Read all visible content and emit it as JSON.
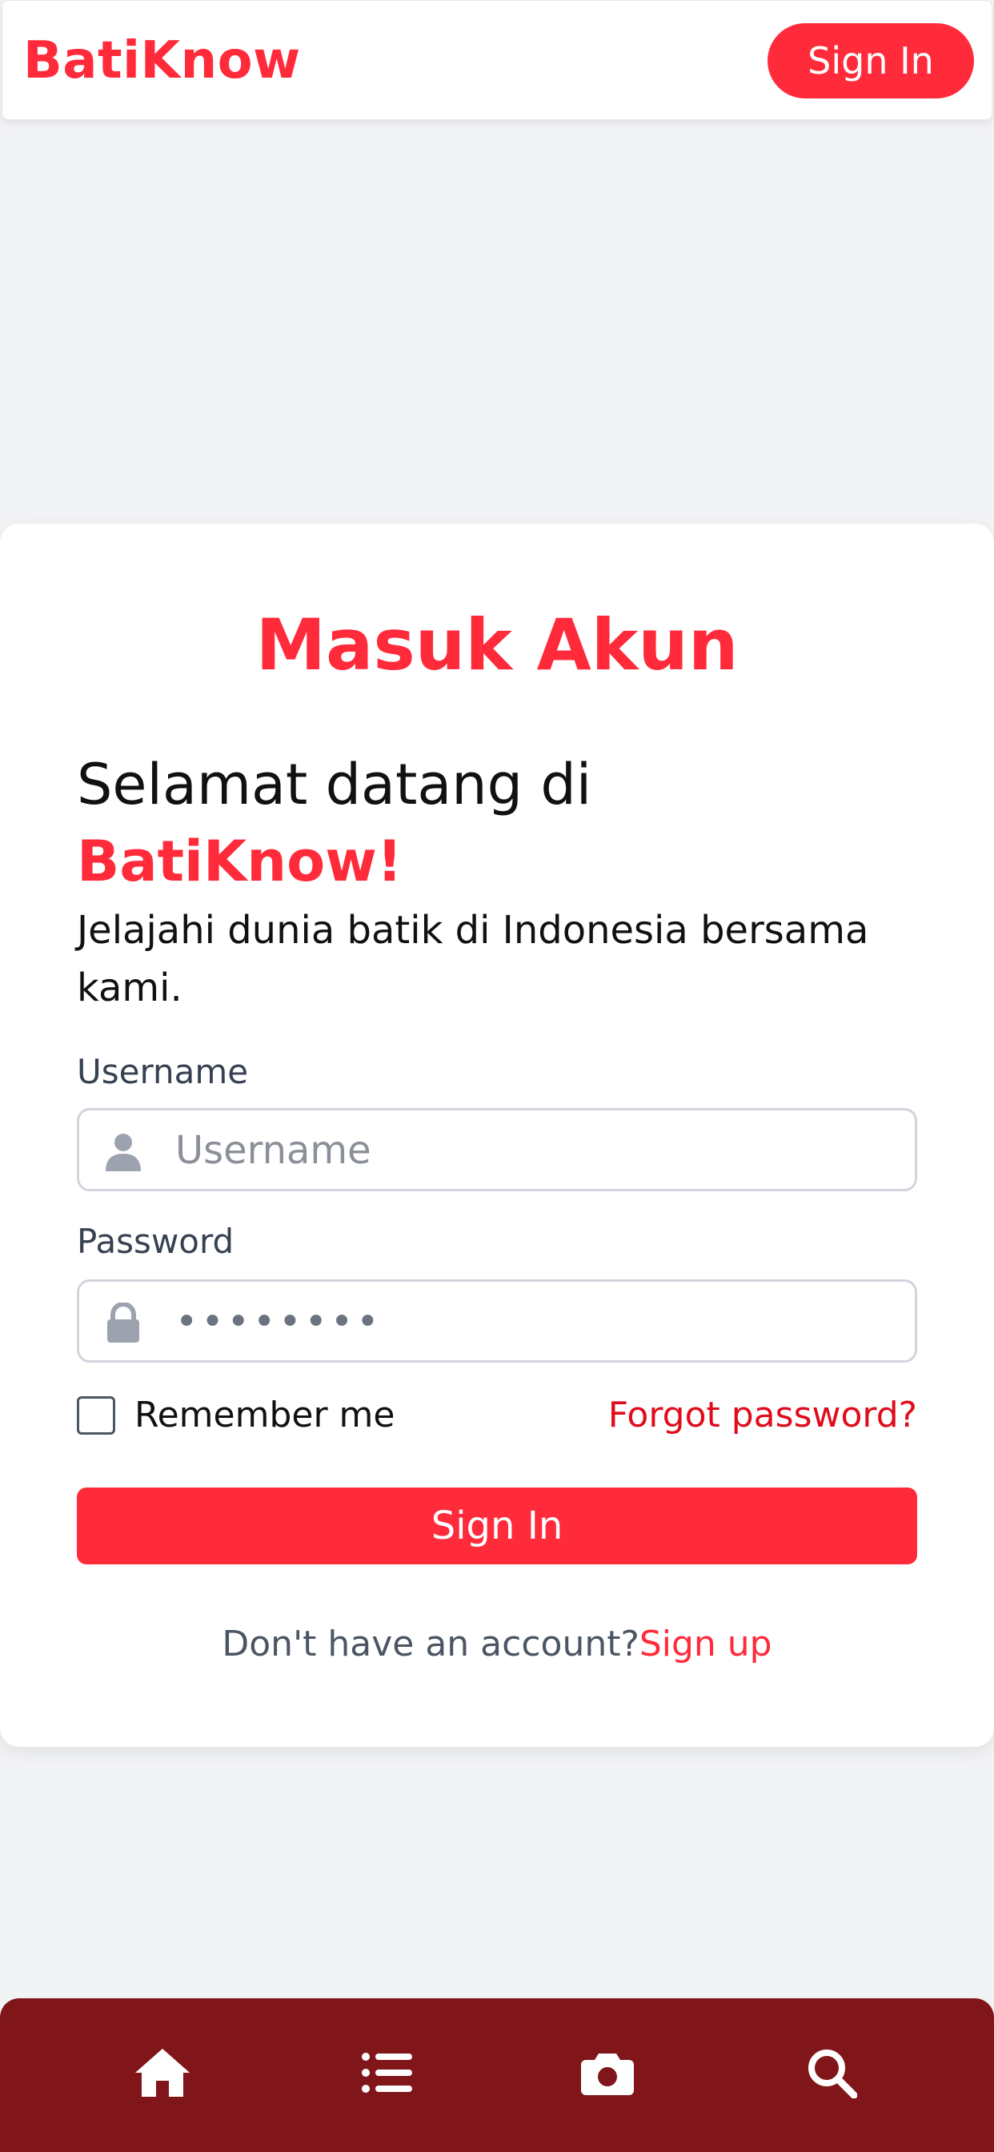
{
  "header": {
    "brand": "BatiKnow",
    "signin_label": "Sign In"
  },
  "card": {
    "title": "Masuk Akun",
    "welcome_line": "Selamat datang di",
    "welcome_brand": "BatiKnow!",
    "subtitle": "Jelajahi dunia batik di Indonesia bersama kami.",
    "username": {
      "label": "Username",
      "placeholder": "Username",
      "value": ""
    },
    "password": {
      "label": "Password",
      "value": "••••••••"
    },
    "remember_label": "Remember me",
    "remember_checked": false,
    "forgot_label": "Forgot password?",
    "signin_label": "Sign In",
    "signup_prompt": "Don't have an account?",
    "signup_link": "Sign up"
  },
  "bottom_nav": {
    "items": [
      {
        "icon": "home-icon"
      },
      {
        "icon": "list-icon"
      },
      {
        "icon": "camera-icon"
      },
      {
        "icon": "search-icon"
      }
    ]
  },
  "colors": {
    "accent": "#ff2a3a",
    "nav_background": "#81161a",
    "page_background": "#f2f3f5"
  }
}
